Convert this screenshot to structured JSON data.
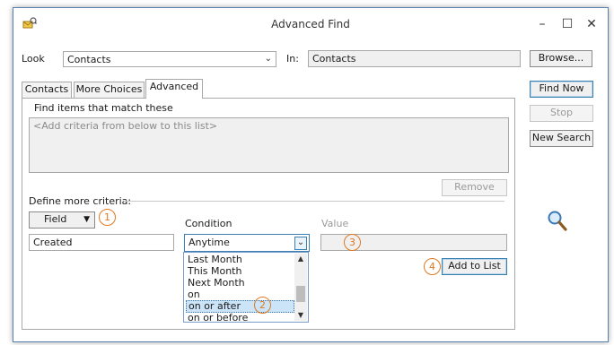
{
  "window": {
    "title": "Advanced Find",
    "minimize_glyph": "–",
    "maximize_glyph": "☐",
    "close_glyph": "✕"
  },
  "look": {
    "label": "Look",
    "value": "Contacts",
    "in_label": "In:",
    "in_value": "Contacts",
    "browse_label": "Browse..."
  },
  "tabs": [
    "Contacts",
    "More Choices",
    "Advanced"
  ],
  "actions": {
    "find_now": "Find Now",
    "stop": "Stop",
    "new_search": "New Search"
  },
  "criteria": {
    "heading": "Find items that match these",
    "placeholder": "<Add criteria from below to this list>",
    "remove_label": "Remove"
  },
  "define": {
    "heading": "Define more criteria:",
    "field_button": "Field",
    "field_value": "Created",
    "condition_label": "Condition",
    "condition_value": "Anytime",
    "condition_options": [
      "Last Month",
      "This Month",
      "Next Month",
      "on",
      "on or after",
      "on or before"
    ],
    "selected_option": "on or after",
    "value_label": "Value",
    "value_text": "",
    "add_to_list": "Add to List"
  },
  "badges": [
    "1",
    "2",
    "3",
    "4"
  ],
  "colors": {
    "badge": "#e07820",
    "selection": "#cce4f7",
    "border_accent": "#5a7fb0"
  },
  "icons": [
    "app-icon",
    "magnifier-icon",
    "chevron-down-icon",
    "scroll-up-icon",
    "scroll-down-icon"
  ]
}
